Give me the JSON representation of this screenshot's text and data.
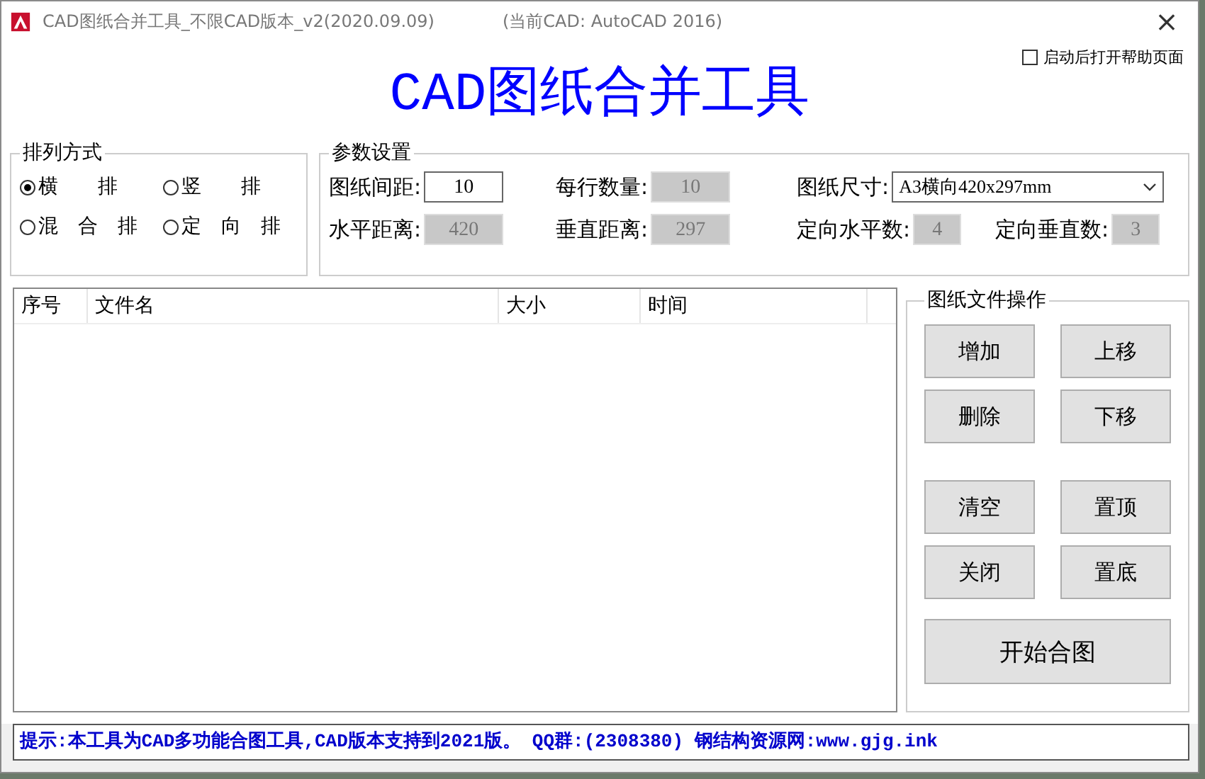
{
  "window": {
    "title": "CAD图纸合并工具_不限CAD版本_v2(2020.09.09)",
    "subtitle": "(当前CAD: AutoCAD 2016)",
    "close": "×"
  },
  "heading": "CAD图纸合并工具",
  "startup_help": {
    "label": "启动后打开帮助页面",
    "checked": false
  },
  "arrangement": {
    "title": "排列方式",
    "options": [
      {
        "label": "横　　排",
        "selected": true
      },
      {
        "label": "竖　　排",
        "selected": false
      },
      {
        "label": "混　合　排",
        "selected": false
      },
      {
        "label": "定　向　排",
        "selected": false
      }
    ]
  },
  "parameters": {
    "title": "参数设置",
    "fields": [
      {
        "label": "图纸间距:",
        "value": "10",
        "disabled": false,
        "kind": "input"
      },
      {
        "label": "每行数量:",
        "value": "10",
        "disabled": true,
        "kind": "input"
      },
      {
        "label": "图纸尺寸:",
        "value": "A3横向420x297mm",
        "kind": "select"
      },
      {
        "label": "水平距离:",
        "value": "420",
        "disabled": true,
        "kind": "input"
      },
      {
        "label": "垂直距离:",
        "value": "297",
        "disabled": true,
        "kind": "input"
      },
      {
        "label": "定向水平数:",
        "value": "4",
        "disabled": true,
        "kind": "small"
      },
      {
        "label": "定向垂直数:",
        "value": "3",
        "disabled": true,
        "kind": "small"
      }
    ]
  },
  "table": {
    "columns": [
      "序号",
      "文件名",
      "大小",
      "时间"
    ]
  },
  "file_operations": {
    "title": "图纸文件操作",
    "buttons": [
      {
        "label": "增加",
        "kind": "small"
      },
      {
        "label": "上移",
        "kind": "small"
      },
      {
        "label": "删除",
        "kind": "small"
      },
      {
        "label": "下移",
        "kind": "small"
      },
      {
        "label": "清空",
        "kind": "small"
      },
      {
        "label": "置顶",
        "kind": "small"
      },
      {
        "label": "关闭",
        "kind": "small"
      },
      {
        "label": "置底",
        "kind": "small"
      },
      {
        "label": "开始合图",
        "kind": "wide"
      }
    ]
  },
  "status_bar": "提示:本工具为CAD多功能合图工具,CAD版本支持到2021版。 QQ群:(2308380)  钢结构资源网:www.gjg.ink"
}
